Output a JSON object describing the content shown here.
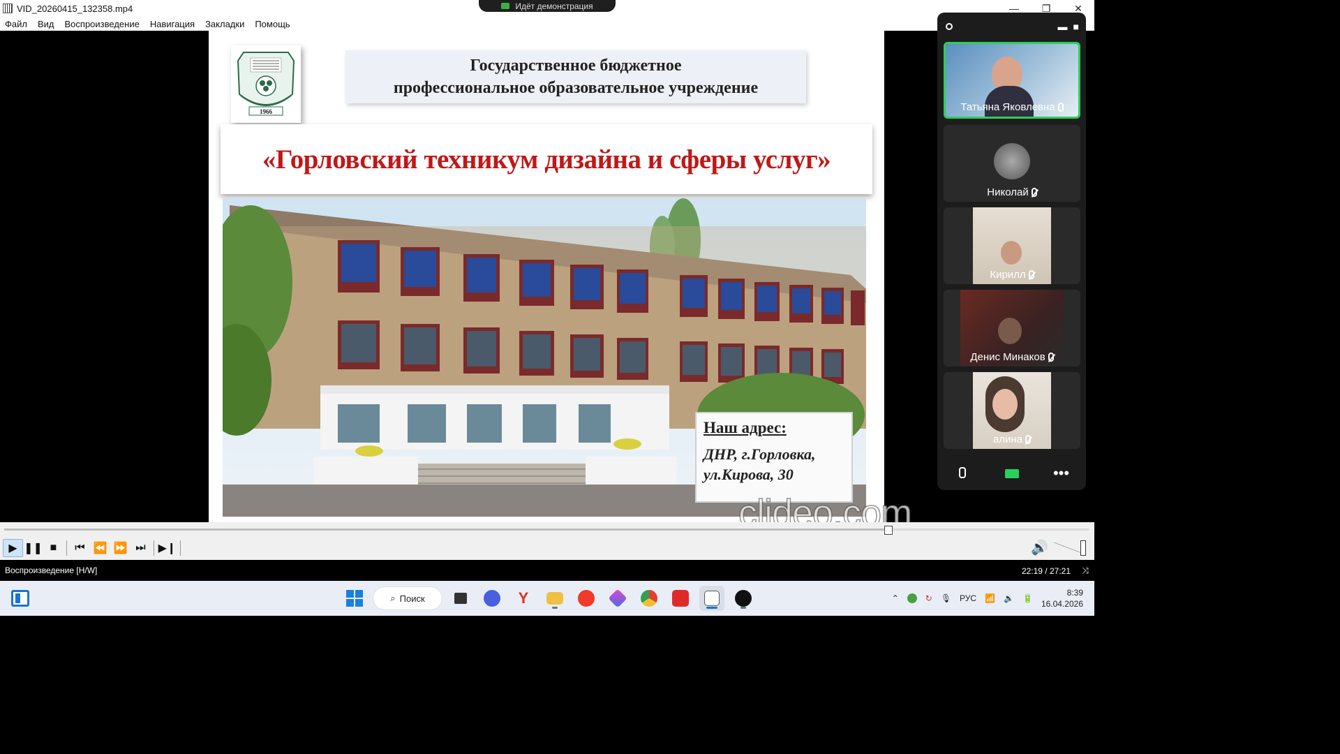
{
  "window": {
    "title": "VID_20260415_132358.mp4",
    "share_indicator": "Идёт демонстрация",
    "controls": {
      "minimize": "—",
      "restore": "❐",
      "close": "✕"
    }
  },
  "menu": [
    "Файл",
    "Вид",
    "Воспроизведение",
    "Навигация",
    "Закладки",
    "Помощь"
  ],
  "slide": {
    "logo_year": "1966",
    "header_line1": "Государственное бюджетное",
    "header_line2": "профессиональное образовательное учреждение",
    "institution_name": "«Горловский техникум дизайна и сферы услуг»",
    "address_title": "Наш адрес",
    "address_title_suffix": ":",
    "address_line1": "ДНР, г.Горловка,",
    "address_line2": "ул.Кирова, 30",
    "watermark": "clideo.com"
  },
  "zoom": {
    "participants": [
      {
        "name": "Татьяна Яковлевна",
        "active": true
      },
      {
        "name": "Николай",
        "active": false
      },
      {
        "name": "Кирилл",
        "active": false
      },
      {
        "name": "Денис Минаков",
        "active": false
      },
      {
        "name": "алина",
        "active": false
      }
    ],
    "buttons": [
      "microphone",
      "screen-share",
      "more"
    ]
  },
  "player": {
    "progress": 0.815,
    "status": "Воспроизведение [H/W]",
    "time": "22:19 / 27:21"
  },
  "taskbar": {
    "search_label": "Поиск",
    "language": "РУС",
    "time": "8:39",
    "date": "16.04.2026"
  }
}
